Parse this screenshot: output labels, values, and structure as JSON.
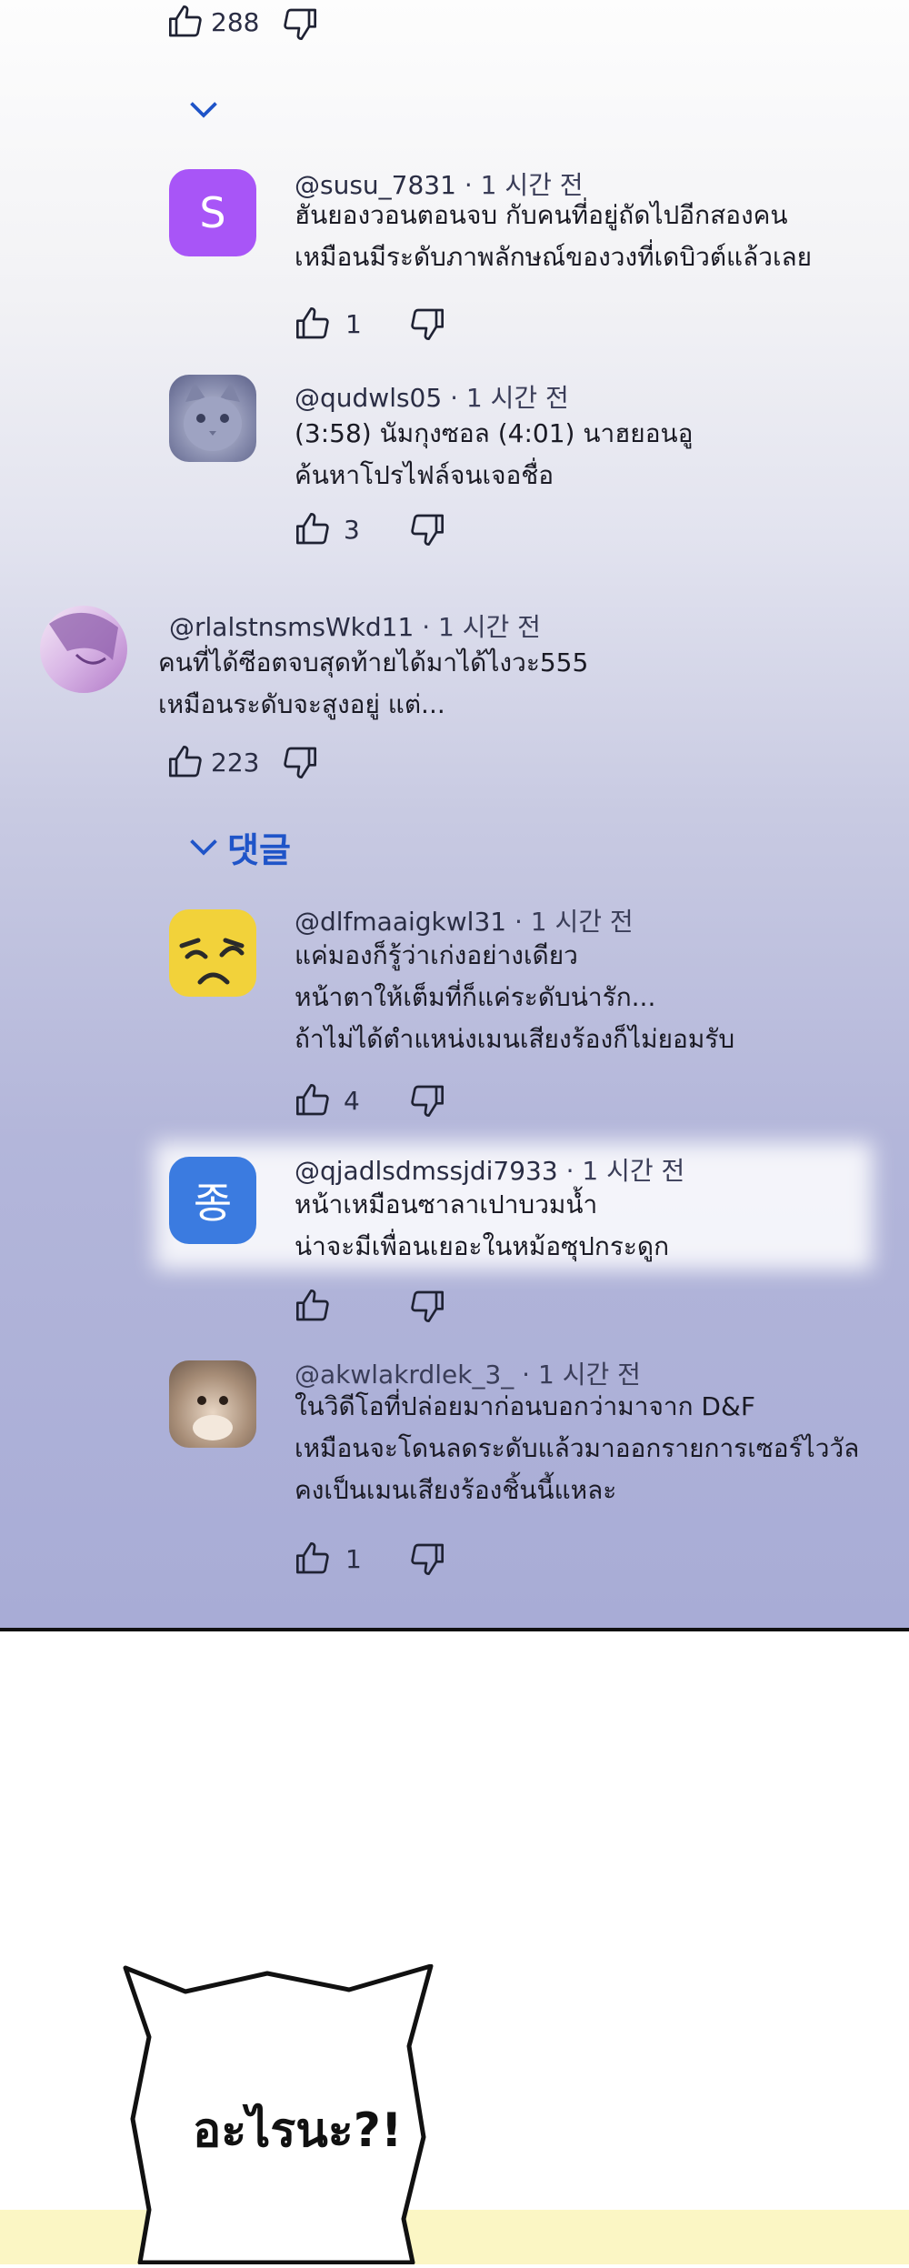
{
  "top_comment": {
    "likes": "288"
  },
  "comments": [
    {
      "id": "c1",
      "avatar_letter": "S",
      "avatar_color": "#a855f7",
      "handle": "@susu_7831",
      "time": "· 1 시간 전",
      "lines": [
        "ฮันยองวอนตอนจบ กับคนที่อยู่ถัดไปอีกสองคน",
        "เหมือนมีระดับภาพลักษณ์ของวงที่เดบิวต์แล้วเลย"
      ],
      "likes": "1"
    },
    {
      "id": "c2",
      "handle": "@qudwls05",
      "time": "· 1 시간 전",
      "lines": [
        "(3:58) นัมกุงซอล (4:01) นาฮยอนอู",
        "ค้นหาโปรไฟล์จนเจอชื่อ"
      ],
      "likes": "3"
    },
    {
      "id": "c3",
      "handle": "@rlalstnsmsWkd11",
      "time": "· 1 시간 전",
      "lines": [
        "คนที่ได้ซีอตจบสุดท้ายได้มาได้ไงวะ555",
        "เหมือนระดับจะสูงอยู่ แต่..."
      ],
      "likes": "223"
    },
    {
      "id": "c4",
      "handle": "@dlfmaaigkwl31",
      "time": "· 1 시간 전",
      "lines": [
        "แค่มองก็รู้ว่าเก่งอย่างเดียว",
        "หน้าตาให้เต็มที่ก็แค่ระดับน่ารัก...",
        "ถ้าไม่ได้ตำแหน่งเมนเสียงร้องก็ไม่ยอมรับ"
      ],
      "likes": "4"
    },
    {
      "id": "c5",
      "avatar_letter": "종",
      "avatar_color": "#3b7be0",
      "handle": "@qjadlsdmssjdi7933",
      "time": "· 1 시간 전",
      "lines": [
        "หน้าเหมือนซาลาเปาบวมน้ำ",
        "น่าจะมีเพื่อนเยอะในหม้อซุปกระดูก"
      ],
      "likes": ""
    },
    {
      "id": "c6",
      "handle": "@akwlakrdlek_3_",
      "time": "· 1 시간 전",
      "lines": [
        "ในวิดีโอที่ปล่อยมาก่อนบอกว่ามาจาก D&F",
        "เหมือนจะโดนลดระดับแล้วมาออกรายการเซอร์ไววัล",
        "คงเป็นเมนเสียงร้องชิ้นนี้แหละ"
      ],
      "likes": "1"
    }
  ],
  "replies_link": {
    "label": "댓글"
  },
  "speech_bubble": {
    "text": "อะไรนะ?!"
  },
  "colors": {
    "accent": "#1f54c8",
    "panel_bottom": "#a8acd6"
  }
}
